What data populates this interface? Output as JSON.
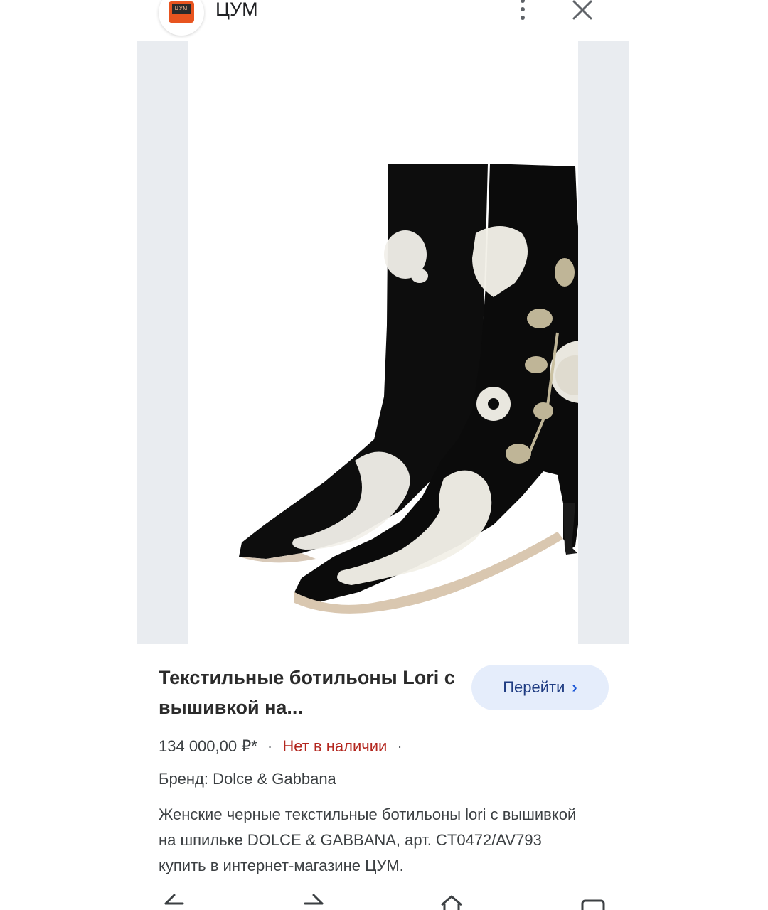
{
  "header": {
    "site_name": "ЦУМ",
    "site_icon_text": "ЦУМ",
    "more_icon": "more-vert-icon",
    "close_icon": "close-icon"
  },
  "product": {
    "image_alt": "Ботильоны Dolce & Gabbana с вышивкой",
    "title": "Текстильные ботильоны Lori с вышивкой на...",
    "go_button_label": "Перейти",
    "go_button_chevron": "›",
    "price": "134 000,00 ₽*",
    "separator": "·",
    "availability": "Нет в наличии",
    "brand": "Бренд: Dolce & Gabbana",
    "description": "Женские черные текстильные ботильоны lori с вышивкой на шпильке DOLCE & GABBANA, арт. CT0472/AV793 купить в интернет-магазине ЦУМ."
  },
  "bottom_nav": {
    "items": [
      "back-icon",
      "forward-icon",
      "home-icon",
      "tabs-icon"
    ]
  },
  "colors": {
    "brand_orange": "#e8541f",
    "availability_red": "#b3261e",
    "button_bg": "#e5edfb",
    "button_text": "#1f3c82"
  }
}
